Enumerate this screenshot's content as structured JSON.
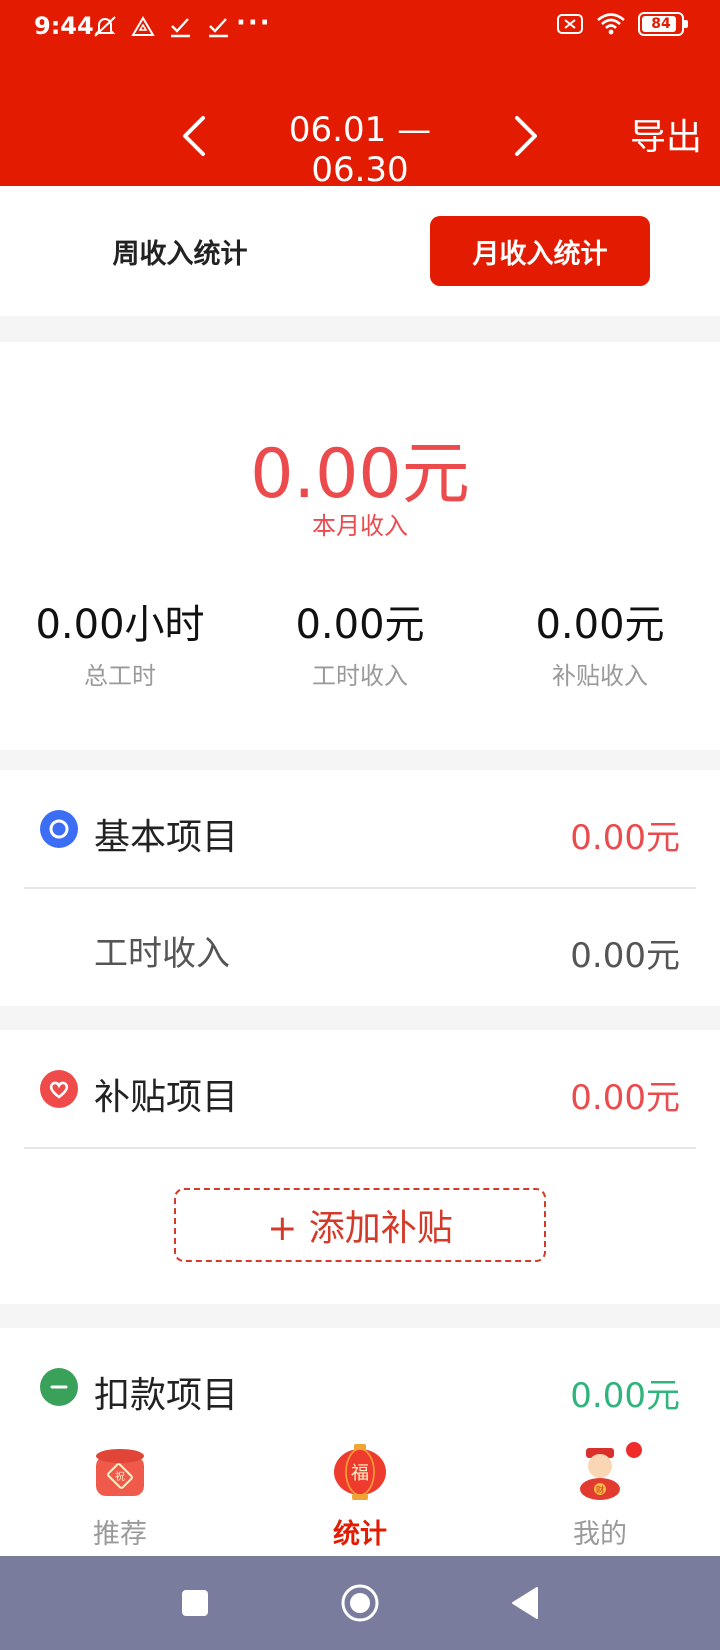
{
  "status_bar": {
    "time": "9:44",
    "more": "···",
    "battery_level": "84"
  },
  "header": {
    "date_range": "06.01 — 06.30",
    "export_label": "导出"
  },
  "tabs": {
    "week_label": "周收入统计",
    "month_label": "月收入统计",
    "active": "month"
  },
  "summary": {
    "month_income_value": "0.00元",
    "month_income_label": "本月收入",
    "stats": [
      {
        "value": "0.00小时",
        "label": "总工时"
      },
      {
        "value": "0.00元",
        "label": "工时收入"
      },
      {
        "value": "0.00元",
        "label": "补贴收入"
      }
    ]
  },
  "basic_section": {
    "title": "基本项目",
    "amount": "0.00元",
    "items": [
      {
        "label": "工时收入",
        "amount": "0.00元"
      }
    ]
  },
  "subsidy_section": {
    "title": "补贴项目",
    "amount": "0.00元",
    "add_label": "+ 添加补贴"
  },
  "deduction_section": {
    "title": "扣款项目",
    "amount": "0.00元"
  },
  "bottom_nav": {
    "items": [
      {
        "label": "推荐",
        "icon": "red-packet-icon"
      },
      {
        "label": "统计",
        "icon": "fu-lantern-icon"
      },
      {
        "label": "我的",
        "icon": "fortune-god-icon"
      }
    ],
    "active_index": 1
  },
  "colors": {
    "brand_red": "#e31b00",
    "amount_red": "#ec4b4e",
    "amount_green": "#2fb47b",
    "system_nav": "#7a7c9d"
  }
}
